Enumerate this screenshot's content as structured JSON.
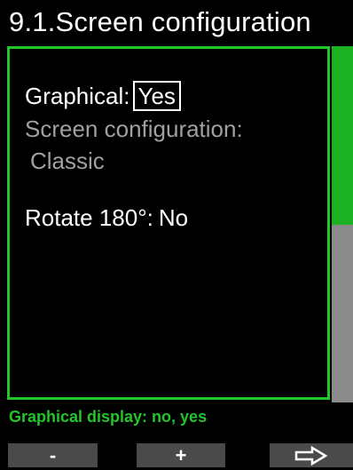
{
  "header": {
    "title": "9.1.Screen configuration"
  },
  "settings": {
    "graphical_label": "Graphical:",
    "graphical_value": "Yes",
    "screen_config_label": "Screen configuration:",
    "screen_config_value": "Classic",
    "rotate_label": "Rotate 180°:",
    "rotate_value": "No"
  },
  "scrollbar": {
    "position_fraction": 0.5,
    "visible_fraction": 0.5
  },
  "help_text": "Graphical display: no, yes",
  "softkeys": {
    "left_label": "-",
    "middle_label": "+",
    "right_icon": "arrow-right-icon"
  },
  "colors": {
    "accent_green": "#22c52a",
    "scroll_thumb": "#1bb123",
    "scroll_track": "#8b8b8b",
    "dim_text": "#a0a0a0",
    "softkey_bg": "#4a4a4a"
  }
}
